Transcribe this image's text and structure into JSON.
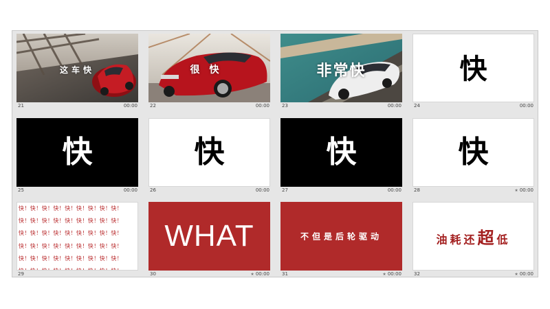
{
  "slides": [
    {
      "number": "21",
      "duration": "00:00",
      "text": "这车快",
      "starred": false
    },
    {
      "number": "22",
      "duration": "00:00",
      "text": "很快",
      "starred": false
    },
    {
      "number": "23",
      "duration": "00:00",
      "text": "非常快",
      "starred": false
    },
    {
      "number": "24",
      "duration": "00:00",
      "text": "快",
      "starred": false
    },
    {
      "number": "25",
      "duration": "00:00",
      "text": "快",
      "starred": false
    },
    {
      "number": "26",
      "duration": "00:00",
      "text": "快",
      "starred": false
    },
    {
      "number": "27",
      "duration": "00:00",
      "text": "快",
      "starred": false
    },
    {
      "number": "28",
      "duration": "00:00",
      "text": "快",
      "starred": true
    },
    {
      "number": "29",
      "duration": "",
      "text": "快！快！快！快！快！快！快！快！快！",
      "starred": false
    },
    {
      "number": "30",
      "duration": "00:00",
      "text": "WHAT",
      "starred": true
    },
    {
      "number": "31",
      "duration": "00:00",
      "text": "不但是后轮驱动",
      "starred": true
    },
    {
      "number": "32",
      "duration": "00:00",
      "text_before": "油耗还",
      "text_emphasis": "超",
      "text_after": "低",
      "starred": true
    }
  ],
  "star_glyph": "★",
  "colors": {
    "red_slide": "#b02a2a",
    "red_text": "#a31f1f",
    "sorter_bg": "#e6e6e6"
  }
}
